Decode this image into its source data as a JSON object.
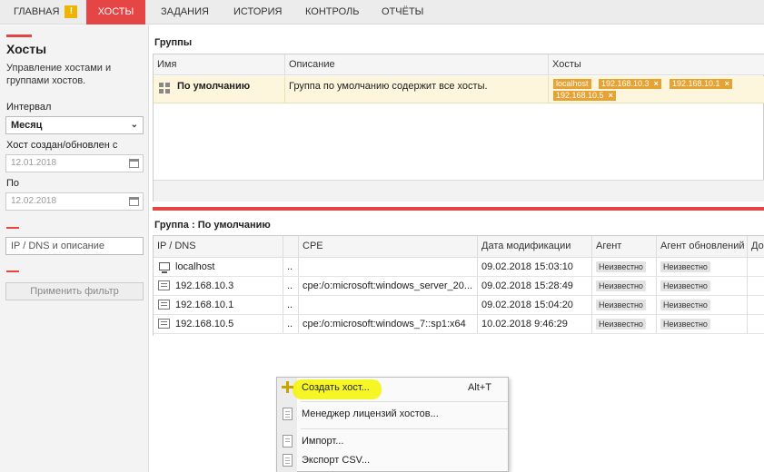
{
  "nav": {
    "items": [
      {
        "label": "ГЛАВНАЯ",
        "warn": "!"
      },
      {
        "label": "ХОСТЫ"
      },
      {
        "label": "ЗАДАНИЯ"
      },
      {
        "label": "ИСТОРИЯ"
      },
      {
        "label": "КОНТРОЛЬ"
      },
      {
        "label": "ОТЧЁТЫ"
      }
    ],
    "active_index": 1
  },
  "sidebar": {
    "title": "Хосты",
    "description": "Управление хостами и группами хостов.",
    "interval_label": "Интервал",
    "interval_value": "Месяц",
    "created_label": "Хост создан/обновлен с",
    "date_from_placeholder": "12.01.2018",
    "to_label": "По",
    "date_to_placeholder": "12.02.2018",
    "search_placeholder": "IP / DNS и описание",
    "apply_label": "Применить фильтр"
  },
  "groups": {
    "title": "Группы",
    "columns": [
      "Имя",
      "Описание",
      "Хосты"
    ],
    "rows": [
      {
        "name": "По умолчанию",
        "description": "Группа по умолчанию содержит все хосты.",
        "hosts": [
          "localhost",
          "192.168.10.3",
          "192.168.10.1",
          "192.168.10.5"
        ],
        "remove_glyph": "×"
      }
    ]
  },
  "hosts_panel": {
    "title": "Группа : По умолчанию",
    "columns": [
      "IP / DNS",
      "",
      "CPE",
      "Дата модификации",
      "Агент",
      "Агент обновлений",
      "До"
    ],
    "rows": [
      {
        "ip": "localhost",
        "more": "..",
        "cpe": "",
        "date": "09.02.2018 15:03:10",
        "agent": "Неизвестно",
        "update_agent": "Неизвестно",
        "icon": "computer-icon"
      },
      {
        "ip": "192.168.10.3",
        "more": "..",
        "cpe": "cpe:/o:microsoft:windows_server_20...",
        "date": "09.02.2018 15:28:49",
        "agent": "Неизвестно",
        "update_agent": "Неизвестно",
        "icon": "server-icon"
      },
      {
        "ip": "192.168.10.1",
        "more": "..",
        "cpe": "",
        "date": "09.02.2018 15:04:20",
        "agent": "Неизвестно",
        "update_agent": "Неизвестно",
        "icon": "server-icon"
      },
      {
        "ip": "192.168.10.5",
        "more": "..",
        "cpe": "cpe:/o:microsoft:windows_7::sp1:x64",
        "date": "10.02.2018 9:46:29",
        "agent": "Неизвестно",
        "update_agent": "Неизвестно",
        "icon": "server-icon"
      }
    ]
  },
  "context_menu": {
    "items": [
      {
        "label": "Создать хост...",
        "shortcut": "Alt+T",
        "icon": "plus-icon"
      },
      {
        "label": "Менеджер лицензий хостов...",
        "shortcut": "",
        "icon": "document-icon"
      },
      {
        "label": "Импорт...",
        "shortcut": "",
        "icon": "import-icon"
      },
      {
        "label": "Экспорт CSV...",
        "shortcut": "",
        "icon": "export-icon"
      }
    ]
  },
  "colors": {
    "accent": "#e64545",
    "tag": "#e6a233",
    "highlight": "#f4f400",
    "selected_row": "#fdf6dc"
  }
}
